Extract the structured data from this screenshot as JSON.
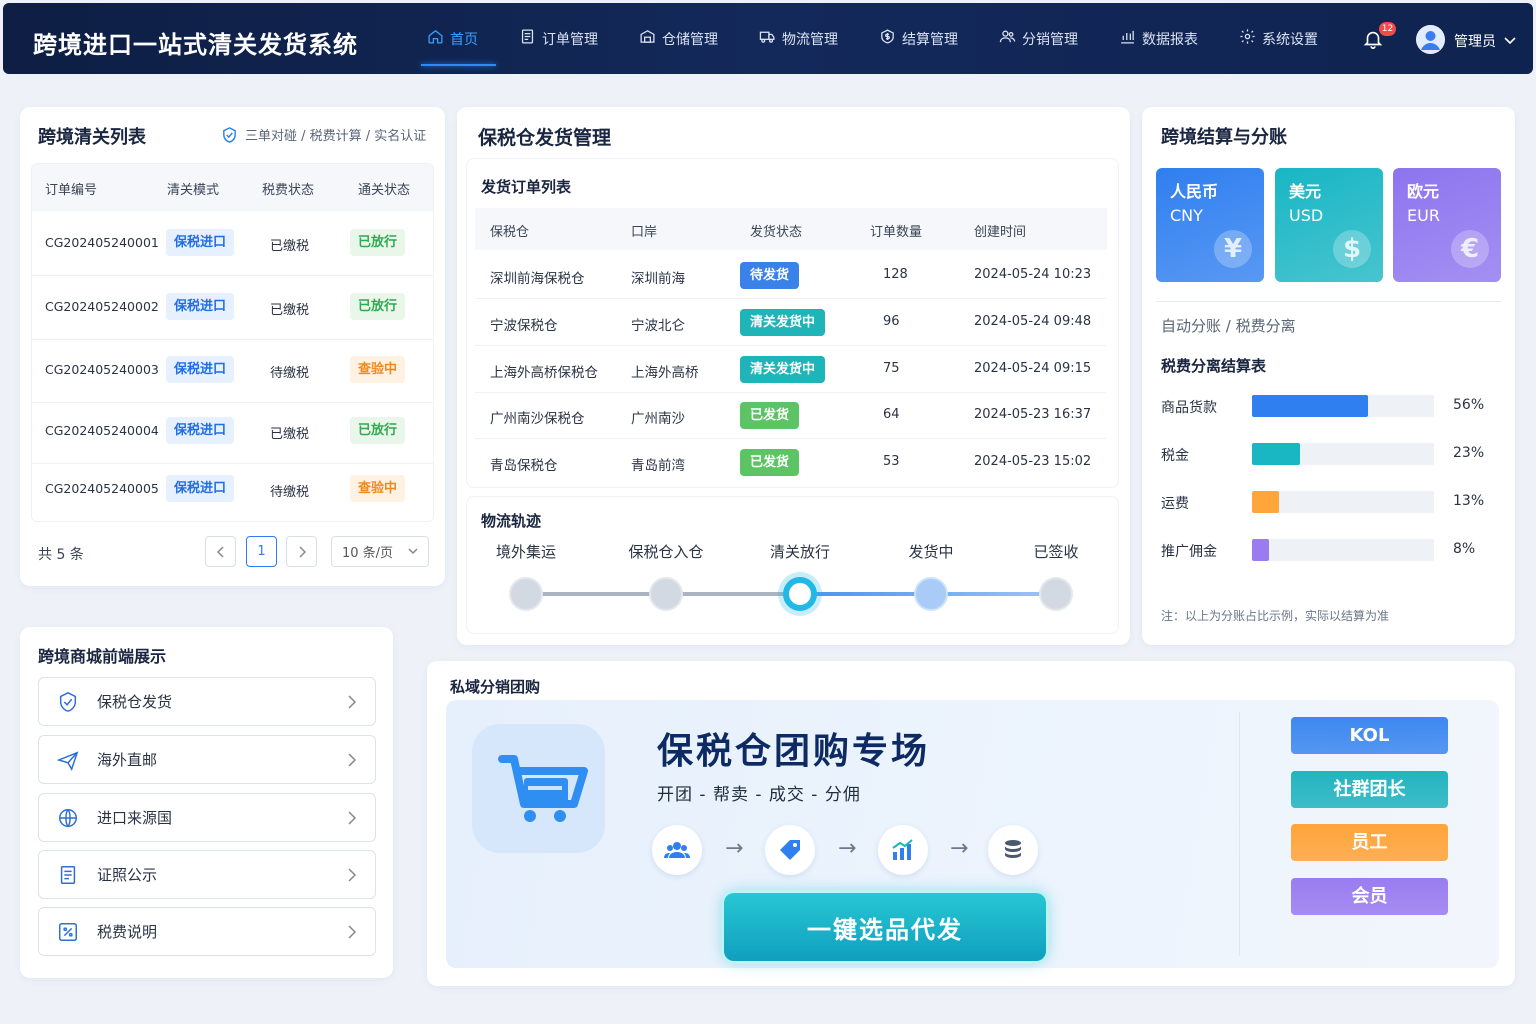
{
  "header": {
    "brand": "跨境进口一站式清关发货系统",
    "nav": [
      {
        "label": "首页",
        "icon": "home-icon"
      },
      {
        "label": "订单管理",
        "icon": "order-icon"
      },
      {
        "label": "仓储管理",
        "icon": "warehouse-icon"
      },
      {
        "label": "物流管理",
        "icon": "truck-icon"
      },
      {
        "label": "结算管理",
        "icon": "settlement-icon"
      },
      {
        "label": "分销管理",
        "icon": "users-icon"
      },
      {
        "label": "数据报表",
        "icon": "chart-icon"
      },
      {
        "label": "系统设置",
        "icon": "gear-icon"
      }
    ],
    "notification_count": "12",
    "user_name": "管理员"
  },
  "clearance": {
    "title": "跨境清关列表",
    "subtitle": "三单对碰 / 税费计算 / 实名认证",
    "columns": [
      "订单编号",
      "清关模式",
      "税费状态",
      "通关状态"
    ],
    "rows": [
      {
        "id": "CG202405240001",
        "mode": "保税进口",
        "tax": "已缴税",
        "status": "已放行",
        "status_type": "green"
      },
      {
        "id": "CG202405240002",
        "mode": "保税进口",
        "tax": "已缴税",
        "status": "已放行",
        "status_type": "green"
      },
      {
        "id": "CG202405240003",
        "mode": "保税进口",
        "tax": "待缴税",
        "status": "查验中",
        "status_type": "orange"
      },
      {
        "id": "CG202405240004",
        "mode": "保税进口",
        "tax": "已缴税",
        "status": "已放行",
        "status_type": "green"
      },
      {
        "id": "CG202405240005",
        "mode": "保税进口",
        "tax": "待缴税",
        "status": "查验中",
        "status_type": "orange"
      }
    ],
    "total": "共 5 条",
    "page": "1",
    "page_size": "10 条/页"
  },
  "warehouse": {
    "title": "保税仓发货管理",
    "orders_title": "发货订单列表",
    "columns": [
      "保税仓",
      "口岸",
      "发货状态",
      "订单数量",
      "创建时间"
    ],
    "rows": [
      {
        "wh": "深圳前海保税仓",
        "port": "深圳前海",
        "status": "待发货",
        "status_type": "blue",
        "qty": "128",
        "time": "2024-05-24 10:23"
      },
      {
        "wh": "宁波保税仓",
        "port": "宁波北仑",
        "status": "清关发货中",
        "status_type": "teal",
        "qty": "96",
        "time": "2024-05-24 09:48"
      },
      {
        "wh": "上海外高桥保税仓",
        "port": "上海外高桥",
        "status": "清关发货中",
        "status_type": "teal",
        "qty": "75",
        "time": "2024-05-24 09:15"
      },
      {
        "wh": "广州南沙保税仓",
        "port": "广州南沙",
        "status": "已发货",
        "status_type": "green",
        "qty": "64",
        "time": "2024-05-23 16:37"
      },
      {
        "wh": "青岛保税仓",
        "port": "青岛前湾",
        "status": "已发货",
        "status_type": "green",
        "qty": "53",
        "time": "2024-05-23 15:02"
      }
    ],
    "logistics_title": "物流轨迹",
    "steps": [
      "境外集运",
      "保税仓入仓",
      "清关放行",
      "发货中",
      "已签收"
    ],
    "current_step": 2
  },
  "settlement": {
    "title": "跨境结算与分账",
    "currencies": [
      {
        "name": "人民币",
        "code": "CNY",
        "symbol": "¥",
        "color": "#2f7ff0"
      },
      {
        "name": "美元",
        "code": "USD",
        "symbol": "$",
        "color": "#19b6c4"
      },
      {
        "name": "欧元",
        "code": "EUR",
        "symbol": "€",
        "color": "#8d74ef"
      }
    ],
    "subtitle": "自动分账 / 税费分离",
    "split_title": "税费分离结算表",
    "items": [
      {
        "label": "商品货款",
        "pct": 56,
        "pct_text": "56%",
        "color": "#2f7ff0"
      },
      {
        "label": "税金",
        "pct": 23,
        "pct_text": "23%",
        "color": "#19b6c4"
      },
      {
        "label": "运费",
        "pct": 13,
        "pct_text": "13%",
        "color": "#ffa53a"
      },
      {
        "label": "推广佣金",
        "pct": 8,
        "pct_text": "8%",
        "color": "#9a7cf0"
      }
    ],
    "note": "注：以上为分账占比示例，实际以结算为准"
  },
  "mall": {
    "title": "跨境商城前端展示",
    "items": [
      {
        "label": "保税仓发货",
        "icon": "shield-icon"
      },
      {
        "label": "海外直邮",
        "icon": "plane-icon"
      },
      {
        "label": "进口来源国",
        "icon": "globe-icon"
      },
      {
        "label": "证照公示",
        "icon": "document-icon"
      },
      {
        "label": "税费说明",
        "icon": "percent-icon"
      }
    ]
  },
  "group": {
    "title": "私域分销团购",
    "headline": "保税仓团购专场",
    "tagline": "开团 - 帮卖 - 成交 - 分佣",
    "cta": "一键选品代发",
    "roles": [
      {
        "label": "KOL",
        "color": "#3d88f0"
      },
      {
        "label": "社群团长",
        "color": "#22b4c0"
      },
      {
        "label": "员工",
        "color": "#ffa43a"
      },
      {
        "label": "会员",
        "color": "#9a7cf0"
      }
    ]
  }
}
